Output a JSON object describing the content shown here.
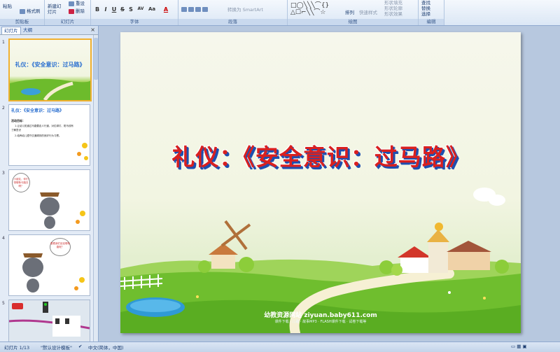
{
  "ribbon": {
    "clipboard": {
      "paste": "粘贴",
      "format_painter": "格式刷",
      "label": "剪贴板"
    },
    "slides": {
      "new_slide": "新建幻灯片",
      "reset": "重设",
      "delete": "删除",
      "label": "幻灯片"
    },
    "font": {
      "label": "字体",
      "bold": "B",
      "italic": "I",
      "underline": "U",
      "strike": "S",
      "shadow": "S",
      "spacing": "AV",
      "case": "Aa",
      "color": "A"
    },
    "paragraph": {
      "label": "段落",
      "convert_smartart": "转换为 SmartArt"
    },
    "drawing": {
      "label": "绘图",
      "arrange": "排列",
      "quick_styles": "快速样式",
      "shape_fill": "形状填充",
      "shape_outline": "形状轮廓",
      "shape_effects": "形状效果"
    },
    "editing": {
      "label": "编辑",
      "find": "查找",
      "replace": "替换",
      "select": "选择"
    }
  },
  "pane": {
    "tab_slides": "幻灯片",
    "tab_outline": "大纲"
  },
  "thumbs": [
    {
      "num": "1",
      "title": "礼仪：《安全意识：过马路》"
    },
    {
      "num": "2",
      "title": "礼仪：《安全意识：过马路》",
      "line1": "活动目标：",
      "line2": "1.让幼儿知道过马路要走人行道，对红绿灯、斑马线有",
      "line3": "了解意识",
      "line4": "2.培养幼儿遵守交通规则的良好行为习惯。"
    },
    {
      "num": "3",
      "bubble": "小朋友，你们带哪条马路去啊？"
    },
    {
      "num": "4",
      "bubble": "看看我们该走哪条路呢？"
    },
    {
      "num": "5"
    }
  ],
  "slide": {
    "title": "礼仪：《安全意识：过马路》",
    "site": "幼教资源网站  ziyuan.baby611.com",
    "site_sub": "课件下载 · 儿歌 · 故事MP3 · FLASH课件下载 · 试卷下载等"
  },
  "status": {
    "slide_count": "幻灯片 1/13",
    "theme": "\"默认设计模板\"",
    "language": "中文(简体，中国)"
  }
}
